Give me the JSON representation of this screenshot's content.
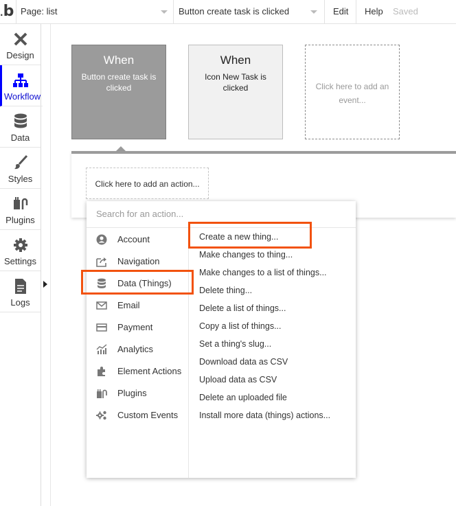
{
  "app": {
    "logo_text": "b"
  },
  "topbar": {
    "page_select": "Page: list",
    "workflow_select": "Button create task is clicked",
    "edit": "Edit",
    "help": "Help",
    "saved": "Saved"
  },
  "sidebar": {
    "items": [
      {
        "label": "Design",
        "icon": "design-icon"
      },
      {
        "label": "Workflow",
        "icon": "workflow-icon",
        "active": true
      },
      {
        "label": "Data",
        "icon": "data-icon"
      },
      {
        "label": "Styles",
        "icon": "styles-icon"
      },
      {
        "label": "Plugins",
        "icon": "plugins-icon"
      },
      {
        "label": "Settings",
        "icon": "settings-icon"
      },
      {
        "label": "Logs",
        "icon": "logs-icon"
      }
    ]
  },
  "events": [
    {
      "when": "When",
      "desc": "Button create task is clicked"
    },
    {
      "when": "When",
      "desc": "Icon New Task is clicked"
    },
    {
      "desc": "Click here to add an event..."
    }
  ],
  "action_panel": {
    "add_action": "Click here to add an action..."
  },
  "dropdown": {
    "search_placeholder": "Search for an action...",
    "categories": [
      {
        "label": "Account",
        "icon": "account-icon"
      },
      {
        "label": "Navigation",
        "icon": "navigation-icon"
      },
      {
        "label": "Data (Things)",
        "icon": "database-icon",
        "selected": true
      },
      {
        "label": "Email",
        "icon": "email-icon"
      },
      {
        "label": "Payment",
        "icon": "payment-icon"
      },
      {
        "label": "Analytics",
        "icon": "analytics-icon"
      },
      {
        "label": "Element Actions",
        "icon": "element-actions-icon"
      },
      {
        "label": "Plugins",
        "icon": "plugins-icon"
      },
      {
        "label": "Custom Events",
        "icon": "custom-events-icon"
      }
    ],
    "actions": [
      "Create a new thing...",
      "Make changes to thing...",
      "Make changes to a list of things...",
      "Delete thing...",
      "Delete a list of things...",
      "Copy a list of things...",
      "Set a thing's slug...",
      "Download data as CSV",
      "Upload data as CSV",
      "Delete an uploaded file",
      "Install more data (things) actions..."
    ]
  },
  "colors": {
    "highlight": "#f2520e",
    "active_nav": "#0000ff",
    "event_selected": "#9b9b9b"
  }
}
